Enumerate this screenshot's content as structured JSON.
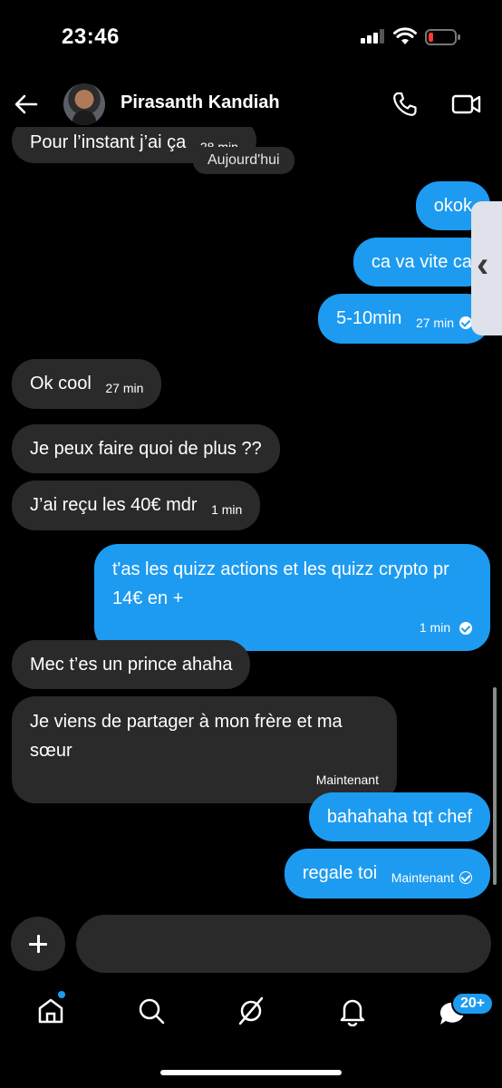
{
  "status_bar": {
    "time": "23:46"
  },
  "header": {
    "contact_name": "Pirasanth Kandiah"
  },
  "conversation": {
    "date_separator": "Aujourd'hui",
    "messages": [
      {
        "dir": "in",
        "text": "Pour l’instant j’ai ça",
        "time": "28 min"
      },
      {
        "dir": "out",
        "text": "okok"
      },
      {
        "dir": "out",
        "text": "ca va vite ca"
      },
      {
        "dir": "out",
        "text": "5-10min",
        "time": "27 min"
      },
      {
        "dir": "in",
        "text": "Ok cool",
        "time": "27 min"
      },
      {
        "dir": "in",
        "text": "Je peux faire quoi de plus ??"
      },
      {
        "dir": "in",
        "text": "J’ai reçu les 40€ mdr",
        "time": "1 min"
      },
      {
        "dir": "out",
        "text": "t'as les quizz actions et les quizz crypto pr 14€ en +",
        "time": "1 min"
      },
      {
        "dir": "in",
        "text": "Mec t’es un prince ahaha"
      },
      {
        "dir": "in",
        "text": "Je viens de partager à mon frère et ma sœur",
        "time": "Maintenant"
      },
      {
        "dir": "out",
        "text": "bahahaha tqt chef"
      },
      {
        "dir": "out",
        "text": "regale toi",
        "time": "Maintenant"
      }
    ]
  },
  "composer": {
    "placeholder": ""
  },
  "tabbar": {
    "messages_badge": "20+"
  },
  "colors": {
    "accent": "#1d9bf0",
    "incoming_bubble": "#2a2a2a",
    "background": "#000000"
  },
  "icons": [
    "back-arrow-icon",
    "phone-icon",
    "video-icon",
    "home-icon",
    "search-icon",
    "grok-icon",
    "bell-icon",
    "messages-icon"
  ]
}
